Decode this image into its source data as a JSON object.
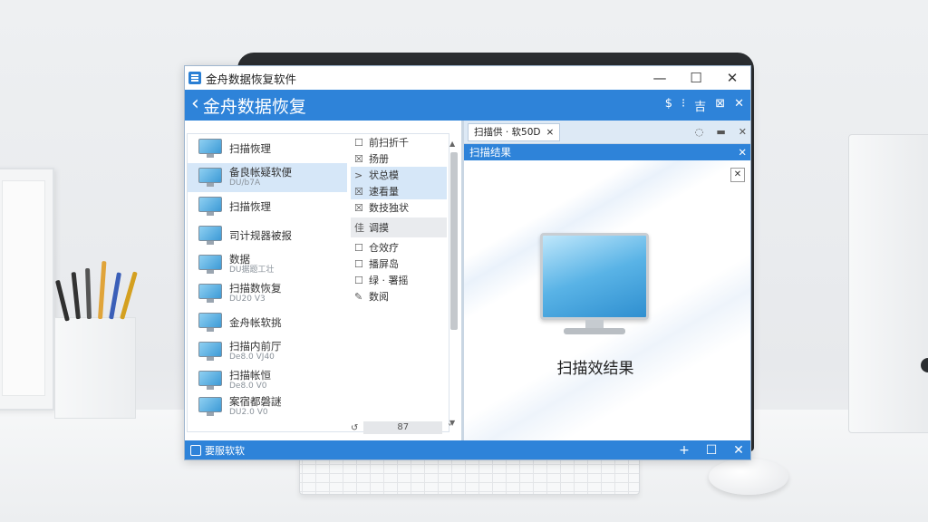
{
  "window": {
    "title": "金舟数据恢复软件",
    "controls": {
      "minimize": "—",
      "maximize": "☐",
      "close": "✕"
    }
  },
  "header": {
    "back_glyph": "‹",
    "title": "金舟数据恢复",
    "icons": [
      "$",
      "⁝",
      "吉",
      "⊠",
      "✕"
    ]
  },
  "files": [
    {
      "name": "扫描恢理",
      "sub": ""
    },
    {
      "name": "备良帐疑软便",
      "sub": "DU/b7A"
    },
    {
      "name": "扫描恢理",
      "sub": ""
    },
    {
      "name": "司计规器被报",
      "sub": ""
    },
    {
      "name": "数据",
      "sub": "DU据题工壮"
    },
    {
      "name": "扫描数恢复",
      "sub": "DU20 V3"
    },
    {
      "name": "金舟帐软挑",
      "sub": ""
    },
    {
      "name": "扫描内前厅",
      "sub": "De8.0 VJ40"
    },
    {
      "name": "扫描帐恒",
      "sub": "De8.0 V0"
    },
    {
      "name": "案宿都磐謎",
      "sub": "DU2.0 V0"
    }
  ],
  "options": [
    {
      "glyph": "☐",
      "label": "前扫折千"
    },
    {
      "glyph": "☒",
      "label": "扬册"
    },
    {
      "glyph": ">",
      "label": "状总模"
    },
    {
      "glyph": "☒",
      "label": "速看量"
    },
    {
      "glyph": "☒",
      "label": "数技独状"
    },
    {
      "glyph": "佳",
      "label": "调摸"
    },
    {
      "glyph": "☐",
      "label": "仓效疗"
    },
    {
      "glyph": "☐",
      "label": "播屏岛"
    },
    {
      "glyph": "☐",
      "label": "绿 · 署摇"
    },
    {
      "glyph": "✎",
      "label": "数阅"
    }
  ],
  "bottom_control": {
    "left": "↺",
    "value": "87",
    "right": "˅"
  },
  "right_tab": {
    "label": "扫描供 · 软50D",
    "close": "×"
  },
  "right_tools": [
    "◌",
    "▬",
    "✕"
  ],
  "right_header": {
    "title": "扫描结果",
    "icon": "✕"
  },
  "panel_close": "✕",
  "result_caption": "扫描效结果",
  "statusbar": {
    "text": "要服软软",
    "buttons": [
      "+",
      "☐",
      "✕"
    ]
  }
}
